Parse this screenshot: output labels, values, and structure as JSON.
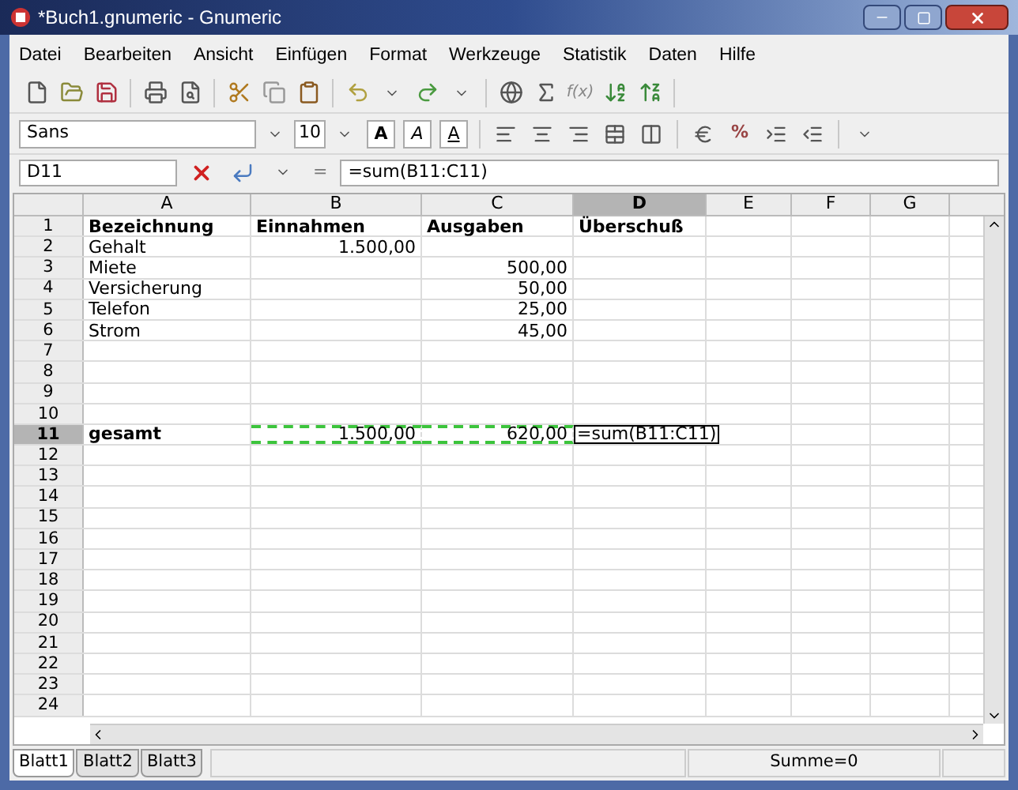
{
  "window": {
    "title": "*Buch1.gnumeric - Gnumeric"
  },
  "menu": [
    "Datei",
    "Bearbeiten",
    "Ansicht",
    "Einfügen",
    "Format",
    "Werkzeuge",
    "Statistik",
    "Daten",
    "Hilfe"
  ],
  "toolbar": {
    "function_label": "f(x)"
  },
  "format_bar": {
    "font": "Sans",
    "size": "10",
    "bold": "A",
    "italic": "A",
    "underline": "A",
    "percent": "%"
  },
  "formula_bar": {
    "cell": "D11",
    "equals": "=",
    "formula": "=sum(B11:C11)"
  },
  "columns": [
    {
      "label": "A",
      "selected": false
    },
    {
      "label": "B",
      "selected": false
    },
    {
      "label": "C",
      "selected": false
    },
    {
      "label": "D",
      "selected": true
    },
    {
      "label": "E",
      "selected": false
    },
    {
      "label": "F",
      "selected": false
    },
    {
      "label": "G",
      "selected": false
    }
  ],
  "rows": [
    {
      "number": "1",
      "selected": false,
      "cells": [
        {
          "kind": "heading",
          "text": "Bezeichnung"
        },
        {
          "kind": "heading",
          "text": "Einnahmen"
        },
        {
          "kind": "heading",
          "text": "Ausgaben"
        },
        {
          "kind": "heading",
          "text": "Überschuß"
        }
      ]
    },
    {
      "number": "2",
      "selected": false,
      "cells": [
        {
          "kind": "label",
          "text": "Gehalt"
        },
        {
          "kind": "number",
          "text": "1.500,00"
        }
      ]
    },
    {
      "number": "3",
      "selected": false,
      "cells": [
        {
          "kind": "label",
          "text": "Miete"
        },
        {
          "kind": "empty"
        },
        {
          "kind": "number",
          "text": "500,00"
        }
      ]
    },
    {
      "number": "4",
      "selected": false,
      "cells": [
        {
          "kind": "label",
          "text": "Versicherung"
        },
        {
          "kind": "empty"
        },
        {
          "kind": "number",
          "text": "50,00"
        }
      ]
    },
    {
      "number": "5",
      "selected": false,
      "cells": [
        {
          "kind": "label",
          "text": "Telefon"
        },
        {
          "kind": "empty"
        },
        {
          "kind": "number",
          "text": "25,00"
        }
      ]
    },
    {
      "number": "6",
      "selected": false,
      "cells": [
        {
          "kind": "label",
          "text": "Strom"
        },
        {
          "kind": "empty"
        },
        {
          "kind": "number",
          "text": "45,00"
        }
      ]
    },
    {
      "number": "7",
      "selected": false,
      "cells": []
    },
    {
      "number": "8",
      "selected": false,
      "cells": []
    },
    {
      "number": "9",
      "selected": false,
      "cells": []
    },
    {
      "number": "10",
      "selected": false,
      "cells": []
    },
    {
      "number": "11",
      "selected": true,
      "cells": [
        {
          "kind": "heading",
          "text": "gesamt"
        },
        {
          "kind": "marquee",
          "text": "1.500,00"
        },
        {
          "kind": "marquee",
          "text": "620,00"
        },
        {
          "kind": "editing",
          "text": "=sum(B11:C11)"
        }
      ]
    },
    {
      "number": "12",
      "selected": false,
      "cells": []
    },
    {
      "number": "13",
      "selected": false,
      "cells": []
    },
    {
      "number": "14",
      "selected": false,
      "cells": []
    },
    {
      "number": "15",
      "selected": false,
      "cells": []
    },
    {
      "number": "16",
      "selected": false,
      "cells": []
    },
    {
      "number": "17",
      "selected": false,
      "cells": []
    },
    {
      "number": "18",
      "selected": false,
      "cells": []
    },
    {
      "number": "19",
      "selected": false,
      "cells": []
    },
    {
      "number": "20",
      "selected": false,
      "cells": []
    },
    {
      "number": "21",
      "selected": false,
      "cells": []
    },
    {
      "number": "22",
      "selected": false,
      "cells": []
    },
    {
      "number": "23",
      "selected": false,
      "cells": []
    },
    {
      "number": "24",
      "selected": false,
      "cells": []
    }
  ],
  "sheets": [
    {
      "label": "Blatt1",
      "selected": true
    },
    {
      "label": "Blatt2",
      "selected": false
    },
    {
      "label": "Blatt3",
      "selected": false
    }
  ],
  "status_bar": {
    "summary": "Summe=0"
  }
}
